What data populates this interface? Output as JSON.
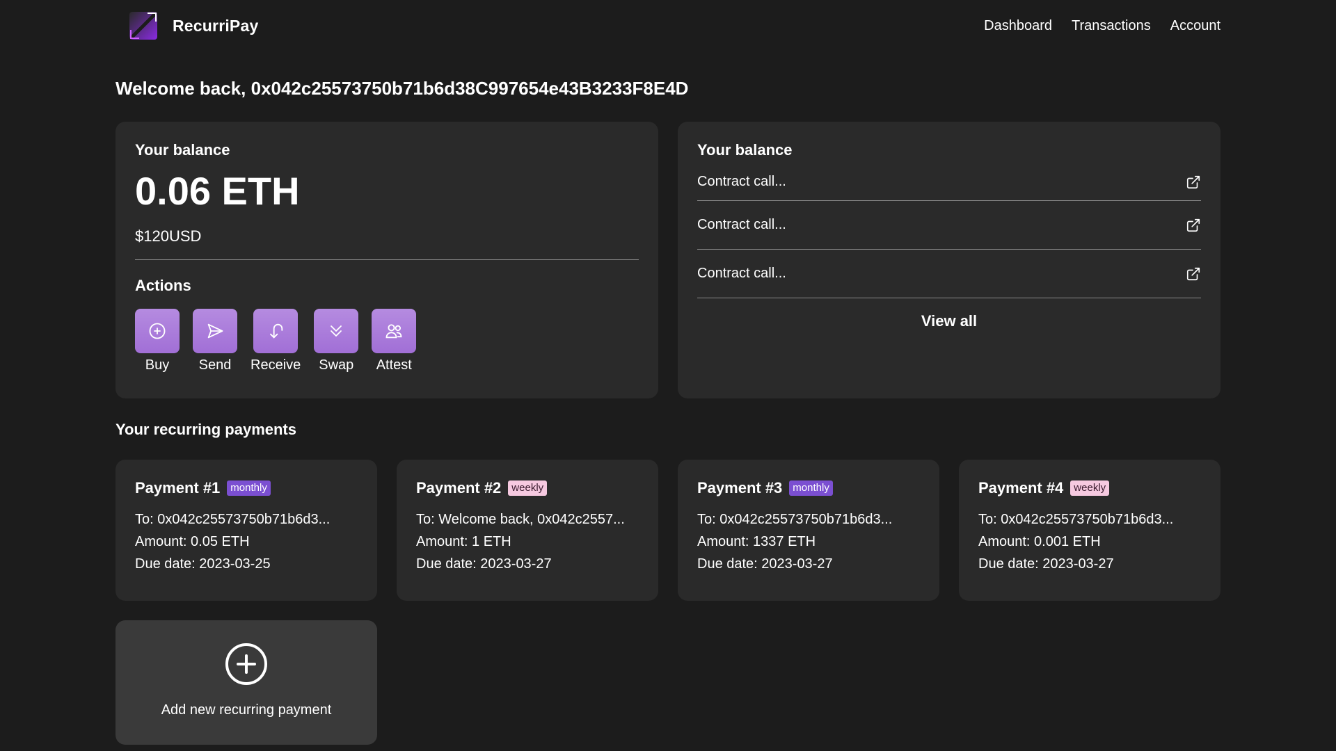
{
  "header": {
    "brand": "RecurriPay",
    "nav": [
      "Dashboard",
      "Transactions",
      "Account"
    ]
  },
  "welcome": "Welcome back, 0x042c25573750b71b6d38C997654e43B3233F8E4D",
  "balance": {
    "title": "Your balance",
    "eth": "0.06 ETH",
    "usd": "$120USD",
    "actions_title": "Actions",
    "actions": [
      {
        "label": "Buy",
        "icon": "plus-circle-icon"
      },
      {
        "label": "Send",
        "icon": "send-icon"
      },
      {
        "label": "Receive",
        "icon": "receive-icon"
      },
      {
        "label": "Swap",
        "icon": "swap-icon"
      },
      {
        "label": "Attest",
        "icon": "users-icon"
      }
    ]
  },
  "activity": {
    "title": "Your balance",
    "items": [
      "Contract call...",
      "Contract call...",
      "Contract call..."
    ],
    "view_all": "View all"
  },
  "payments": {
    "title": "Your recurring payments",
    "items": [
      {
        "name": "Payment #1",
        "badge": "monthly",
        "to": "To: 0x042c25573750b71b6d3...",
        "amount": "Amount: 0.05 ETH",
        "due": "Due date: 2023-03-25"
      },
      {
        "name": "Payment #2",
        "badge": "weekly",
        "to": "To: Welcome back, 0x042c2557...",
        "amount": "Amount: 1 ETH",
        "due": "Due date: 2023-03-27"
      },
      {
        "name": "Payment #3",
        "badge": "monthly",
        "to": "To: 0x042c25573750b71b6d3...",
        "amount": "Amount: 1337 ETH",
        "due": "Due date: 2023-03-27"
      },
      {
        "name": "Payment #4",
        "badge": "weekly",
        "to": "To: 0x042c25573750b71b6d3...",
        "amount": "Amount: 0.001 ETH",
        "due": "Due date: 2023-03-27"
      }
    ],
    "add_label": "Add new recurring payment"
  },
  "colors": {
    "background": "#1c1c1c",
    "card": "#2a2a2a",
    "accent": "#a16fd6",
    "badge_monthly": "#7b4fd1",
    "badge_weekly": "#f6c9e0"
  }
}
